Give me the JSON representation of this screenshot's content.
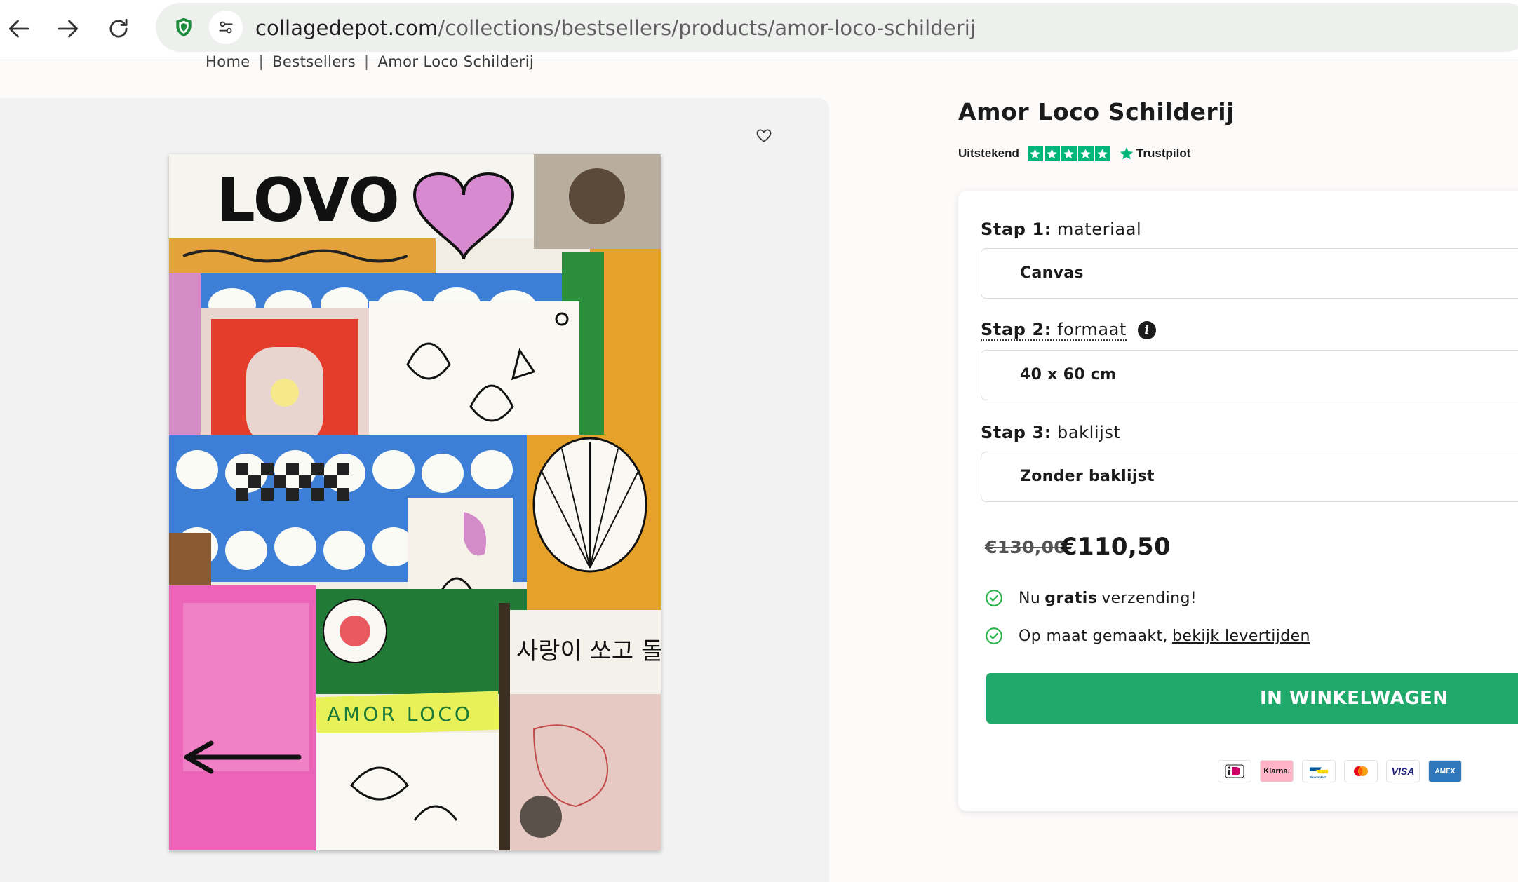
{
  "browser": {
    "url_host": "collagedepot.com",
    "url_path": "/collections/bestsellers/products/amor-loco-schilderij",
    "icons": [
      "back-arrow-icon",
      "forward-arrow-icon",
      "reload-icon",
      "shield-icon",
      "site-settings-icon"
    ]
  },
  "breadcrumb": {
    "items": [
      "Home",
      "Bestsellers",
      "Amor Loco Schilderij"
    ],
    "separator": "|"
  },
  "gallery": {
    "wishlist_icon": "heart-outline-icon",
    "painting_texts": {
      "top_word": "LOVO",
      "label": "AMOR LOCO",
      "korean": "사랑이 쏘고 돌있다"
    }
  },
  "product": {
    "title": "Amor Loco Schilderij",
    "rating_text": "Uitstekend",
    "rating_stars": 5,
    "rating_brand": "Trustpilot",
    "accent_color": "#00b67a"
  },
  "config": {
    "step1": {
      "prefix": "Stap 1:",
      "label": "materiaal",
      "value": "Canvas"
    },
    "step2": {
      "prefix": "Stap 2:",
      "label": "formaat",
      "info": "i",
      "value": "40 x 60 cm"
    },
    "step3": {
      "prefix": "Stap  3:",
      "label": "baklijst",
      "value": "Zonder baklijst"
    },
    "old_price": "€130,00",
    "new_price": "€110,50",
    "usp1": {
      "before": "Nu",
      "bold": "gratis",
      "after": "verzending!"
    },
    "usp2": {
      "before": "Op maat gemaakt,",
      "link": "bekijk levertijden"
    },
    "cart_button": "IN WINKELWAGEN",
    "button_color": "#1faa6b",
    "payments": [
      "iDEAL",
      "Klarna.",
      "Bancontact",
      "Mastercard",
      "VISA",
      "AMEX"
    ]
  }
}
